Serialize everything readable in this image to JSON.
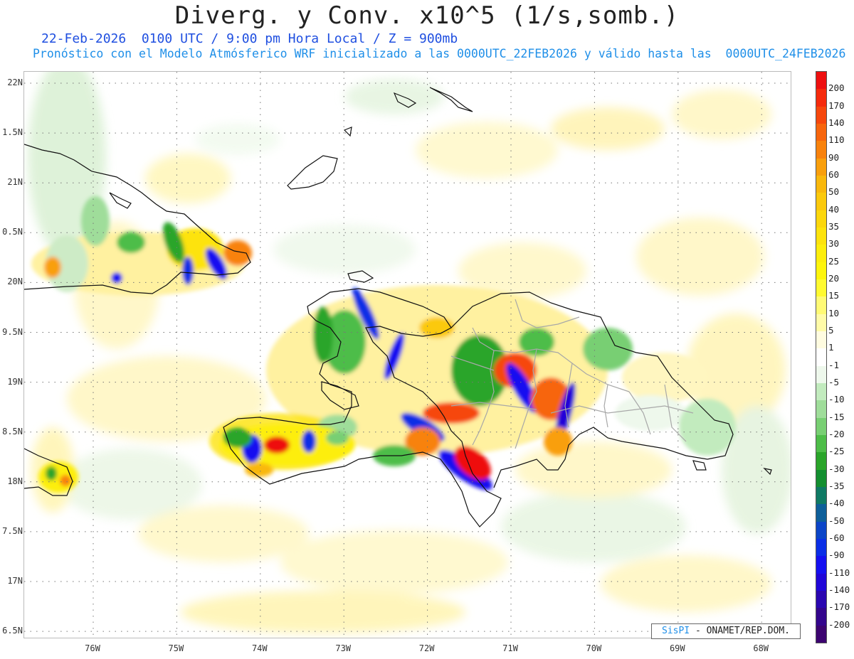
{
  "title": "Diverg. y Conv. x10^5 (1/s,somb.)",
  "subtitle_line1": "22-Feb-2026  0100 UTC / 9:00 pm Hora Local / Z = 900mb",
  "subtitle_line2": "Pronóstico con el Modelo Atmósferico WRF inicializado a las 0000UTC_22FEB2026 y válido hasta las  0000UTC_24FEB2026",
  "lat_labels": [
    "22N",
    "1.5N",
    "21N",
    "0.5N",
    "20N",
    "9.5N",
    "19N",
    "8.5N",
    "18N",
    "7.5N",
    "17N",
    "6.5N"
  ],
  "lon_labels": [
    "76W",
    "75W",
    "74W",
    "73W",
    "72W",
    "71W",
    "70W",
    "69W",
    "68W"
  ],
  "colorbar": {
    "labels": [
      "200",
      "170",
      "140",
      "110",
      "90",
      "60",
      "50",
      "40",
      "35",
      "30",
      "25",
      "20",
      "15",
      "10",
      "5",
      "1",
      "-1",
      "-5",
      "-10",
      "-15",
      "-20",
      "-25",
      "-30",
      "-35",
      "-40",
      "-50",
      "-60",
      "-90",
      "-110",
      "-140",
      "-170",
      "-200"
    ],
    "colors": [
      "#ee1010",
      "#f52a0c",
      "#f6470c",
      "#f7650c",
      "#f8820c",
      "#f99f0c",
      "#f9b80c",
      "#fbc90c",
      "#fcd70c",
      "#fde30c",
      "#fdee0c",
      "#fef50c",
      "#fffa30",
      "#fffa75",
      "#fffba8",
      "#fffce0",
      "#ffffff",
      "#eef8ec",
      "#c2ebbe",
      "#9fdd9a",
      "#78cf73",
      "#4dbd48",
      "#2aa52a",
      "#138f30",
      "#0f7a64",
      "#0e5f9a",
      "#0b45c8",
      "#0a2ee6",
      "#1410f0",
      "#2006d8",
      "#2a06b0",
      "#33058c",
      "#3c0470"
    ]
  },
  "credit": {
    "brand": "SisPI",
    "text": " - ONAMET/REP.DOM."
  }
}
